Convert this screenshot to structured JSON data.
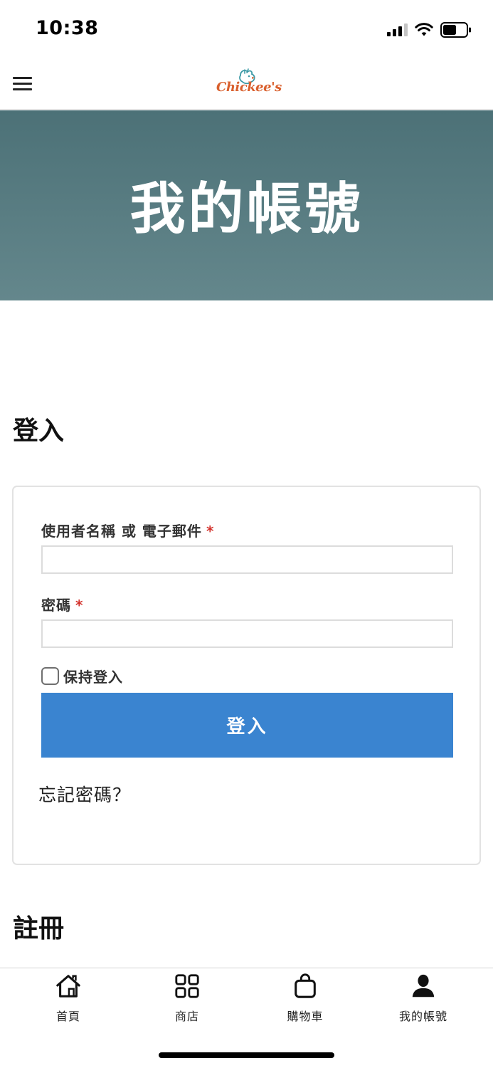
{
  "status_bar": {
    "time": "10:38",
    "icons": [
      "signal-icon",
      "wifi-icon",
      "battery-icon"
    ]
  },
  "header": {
    "menu_icon": "hamburger-menu-icon",
    "logo_text": "Chickee's"
  },
  "hero": {
    "title": "我的帳號",
    "colors": {
      "top": "#4c7177",
      "bottom": "#64878c"
    }
  },
  "login": {
    "title": "登入",
    "username_label": "使用者名稱 或 電子郵件",
    "password_label": "密碼",
    "required_mark": "*",
    "username_value": "",
    "password_value": "",
    "remember_label": "保持登入",
    "remember_checked": false,
    "submit_label": "登入",
    "forgot_link": "忘記密碼？",
    "button_color": "#3a84d0",
    "required_color": "#d3312b"
  },
  "register": {
    "title": "註冊"
  },
  "bottom_nav": {
    "items": [
      {
        "label": "首頁",
        "icon": "home-icon"
      },
      {
        "label": "商店",
        "icon": "grid-icon"
      },
      {
        "label": "購物車",
        "icon": "shopping-bag-icon"
      },
      {
        "label": "我的帳號",
        "icon": "user-icon"
      }
    ]
  }
}
